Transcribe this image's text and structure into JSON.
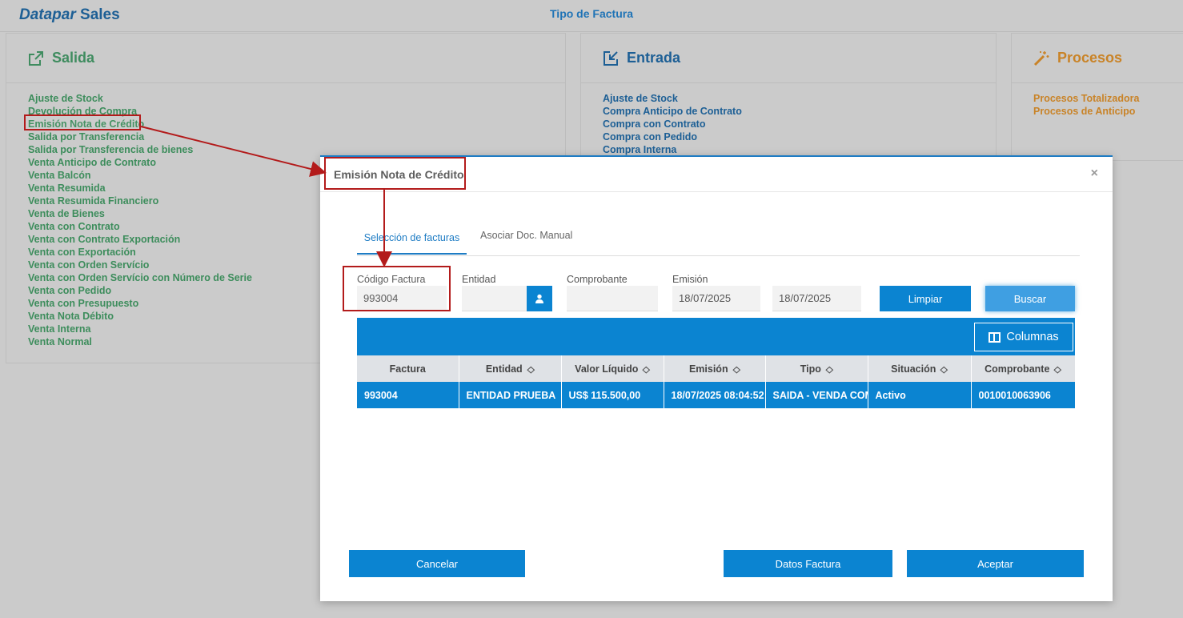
{
  "header": {
    "brand_part1": "Datapar",
    "brand_part2": " Sales",
    "page_title": "Tipo de Factura"
  },
  "colors": {
    "primary": "#0b84d1",
    "salida": "#3d8d5c",
    "entrada": "#1d5f95",
    "procesos": "#c98327",
    "highlight": "#b31b1b"
  },
  "panels": {
    "salida": {
      "title": "Salida",
      "icon": "external-link-icon",
      "items": [
        "Ajuste de Stock",
        "Devolución de Compra",
        "Emisión Nota de Crédito",
        "Salida por Transferencia",
        "Salida por Transferencia de bienes",
        "Venta Anticipo de Contrato",
        "Venta Balcón",
        "Venta Resumida",
        "Venta Resumida Financiero",
        "Venta de Bienes",
        "Venta con Contrato",
        "Venta con Contrato Exportación",
        "Venta con Exportación",
        "Venta con Orden Servício",
        "Venta con Orden Servício con Número de Serie",
        "Venta con Pedido",
        "Venta con Presupuesto",
        "Venta Nota Débito",
        "Venta Interna",
        "Venta Normal"
      ]
    },
    "entrada": {
      "title": "Entrada",
      "icon": "edit-in-icon",
      "items": [
        "Ajuste de Stock",
        "Compra Anticipo de Contrato",
        "Compra con Contrato",
        "Compra con Pedido",
        "Compra Interna"
      ]
    },
    "procesos": {
      "title": "Procesos",
      "icon": "magic-wand-icon",
      "items": [
        "Procesos Totalizadora",
        "Procesos de Anticipo"
      ]
    }
  },
  "modal": {
    "title": "Emisión Nota de Crédito",
    "close": "×",
    "tabs": [
      "Selección de facturas",
      "Asociar Doc. Manual"
    ],
    "filters": {
      "codigo_label": "Código Factura",
      "codigo_value": "993004",
      "entidad_label": "Entidad",
      "entidad_value": "",
      "comprobante_label": "Comprobante",
      "comprobante_value": "",
      "emision_label": "Emisión",
      "emision_from": "18/07/2025",
      "emision_to": "18/07/2025"
    },
    "buttons": {
      "limpiar": "Limpiar",
      "buscar": "Buscar",
      "columnas": "Columnas",
      "cancelar": "Cancelar",
      "datos_factura": "Datos Factura",
      "aceptar": "Aceptar"
    },
    "table": {
      "columns": [
        "Factura",
        "Entidad",
        "Valor Líquido",
        "Emisión",
        "Tipo",
        "Situación",
        "Comprobante"
      ],
      "rows": [
        [
          "993004",
          "ENTIDAD PRUEBA",
          "US$ 115.500,00",
          "18/07/2025 08:04:52",
          "SAIDA - VENDA COM",
          "Activo",
          "0010010063906"
        ]
      ]
    }
  }
}
